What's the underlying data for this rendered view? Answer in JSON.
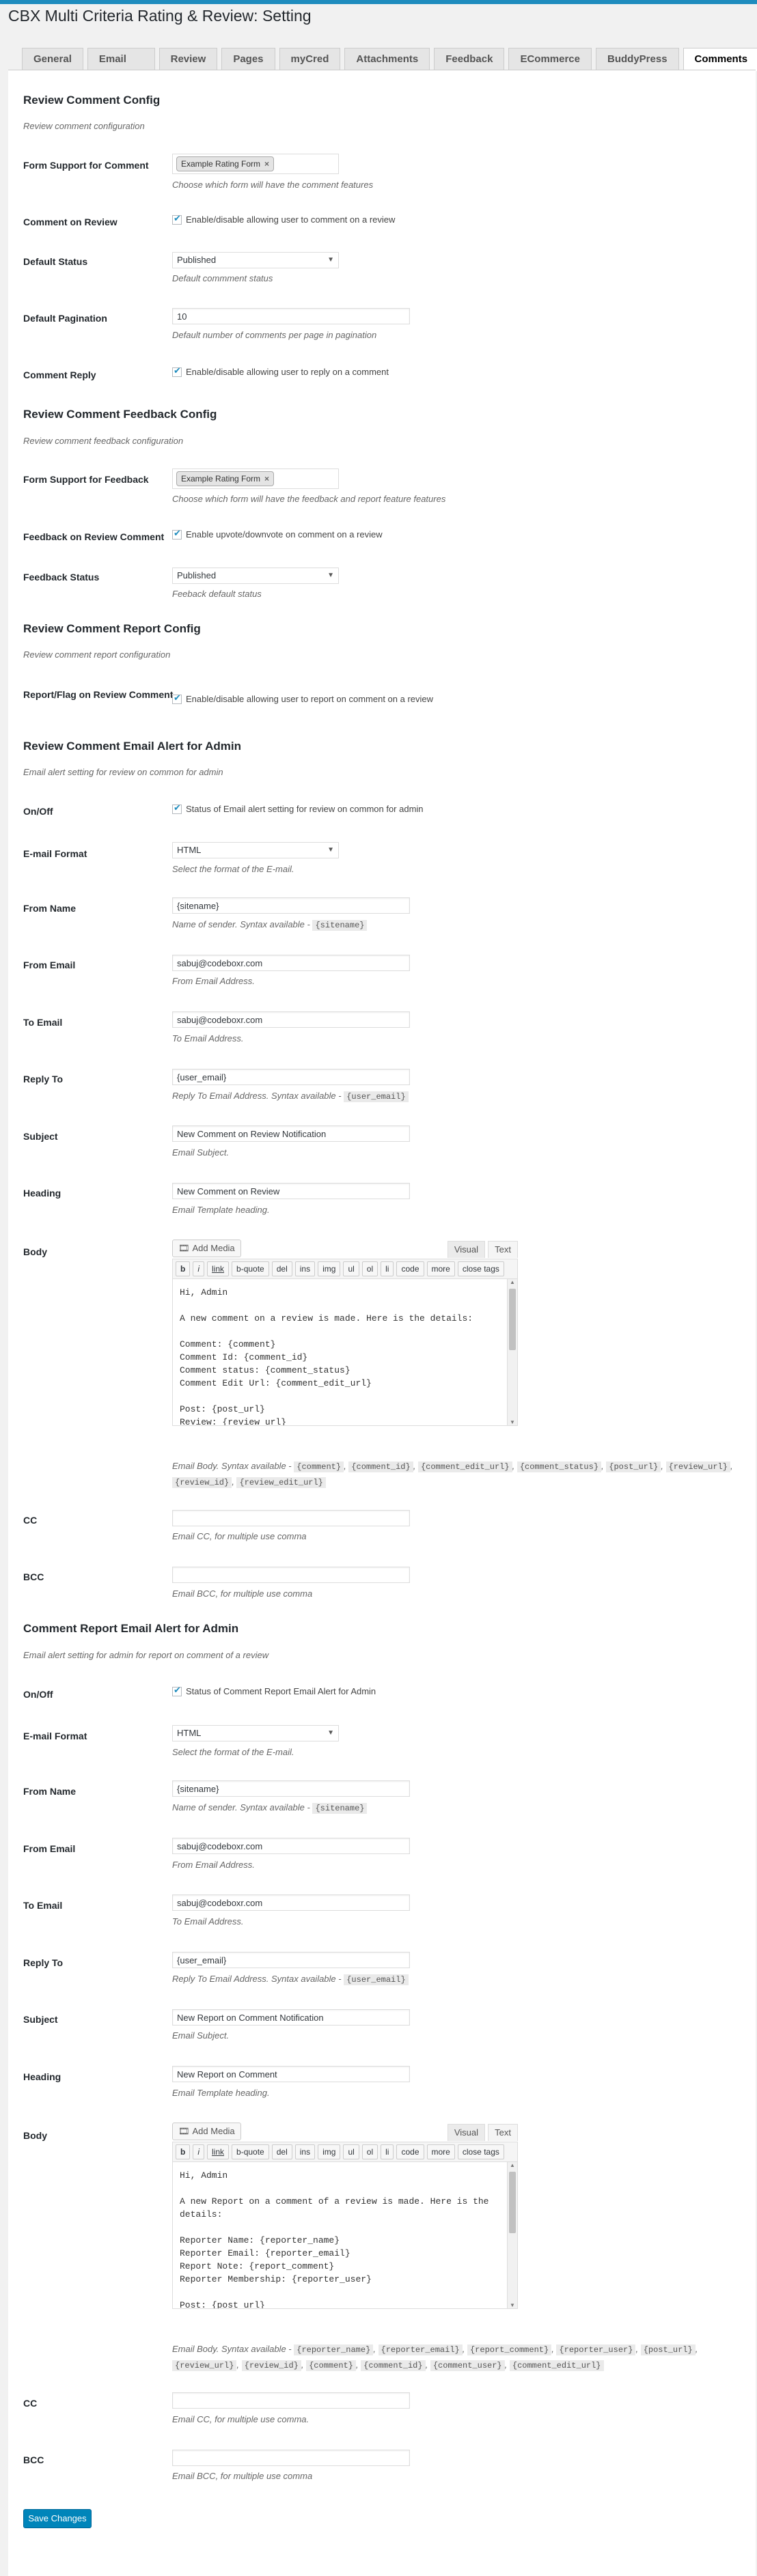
{
  "page": {
    "title": "CBX Multi Criteria Rating & Review: Setting"
  },
  "tabs": [
    "General",
    "Email Template",
    "Review Email",
    "Pages & Tools",
    "myCred",
    "Attachments",
    "Feedback",
    "ECommerce",
    "BuddyPress",
    "Comments"
  ],
  "sections": {
    "comment_config": {
      "title": "Review Comment Config",
      "desc": "Review comment configuration"
    },
    "feedback_config": {
      "title": "Review Comment Feedback Config",
      "desc": "Review comment feedback configuration"
    },
    "report_config": {
      "title": "Review Comment Report Config",
      "desc": "Review comment report configuration"
    },
    "email_alert": {
      "title": "Review Comment Email Alert for Admin",
      "desc": "Email alert setting for review on common for admin"
    },
    "report_email": {
      "title": "Comment Report Email Alert for Admin",
      "desc": "Email alert setting for admin for report on comment of a review"
    }
  },
  "fields": {
    "form_support": {
      "label": "Form Support for Comment",
      "chip": "Example Rating Form",
      "desc": "Choose which form will have the comment features"
    },
    "comment_on_review": {
      "label": "Comment on Review",
      "check": "Enable/disable allowing user to comment on a review"
    },
    "default_status": {
      "label": "Default Status",
      "value": "Published",
      "desc": "Default commment status"
    },
    "default_pagination": {
      "label": "Default Pagination",
      "value": "10",
      "desc": "Default number of comments per page in pagination"
    },
    "comment_reply": {
      "label": "Comment Reply",
      "check": "Enable/disable allowing user to reply on a comment"
    },
    "form_support_feedback": {
      "label": "Form Support for Feedback",
      "chip": "Example Rating Form",
      "desc": "Choose which form will have the feedback and report feature features"
    },
    "feedback_on_review": {
      "label": "Feedback on Review Comment",
      "check": "Enable upvote/downvote on comment on a review"
    },
    "feedback_status": {
      "label": "Feedback Status",
      "value": "Published",
      "desc": "Feeback default status"
    },
    "report_flag": {
      "label": "Report/Flag on Review Comment",
      "check": "Enable/disable allowing user to report on comment on a review"
    }
  },
  "email1": {
    "onoff": {
      "label": "On/Off",
      "check": "Status of Email alert setting for review on common for admin"
    },
    "format": {
      "label": "E-mail Format",
      "value": "HTML",
      "desc": "Select the format of the E-mail."
    },
    "from_name": {
      "label": "From Name",
      "value": "{sitename}",
      "desc": "Name of sender. Syntax available -",
      "code": "{sitename}"
    },
    "from_email": {
      "label": "From Email",
      "value": "sabuj@codeboxr.com",
      "desc": "From Email Address."
    },
    "to_email": {
      "label": "To Email",
      "value": "sabuj@codeboxr.com",
      "desc": "To Email Address."
    },
    "reply_to": {
      "label": "Reply To",
      "value": "{user_email}",
      "desc": "Reply To Email Address. Syntax available -",
      "code": "{user_email}"
    },
    "subject": {
      "label": "Subject",
      "value": "New Comment on Review Notification",
      "desc": "Email Subject."
    },
    "heading": {
      "label": "Heading",
      "value": "New Comment on Review",
      "desc": "Email Template heading."
    },
    "body": {
      "label": "Body",
      "text": "Hi, Admin\n\nA new comment on a review is made. Here is the details:\n\nComment: {comment}\nComment Id: {comment_id}\nComment status: {comment_status}\nComment Edit Url: {comment_edit_url}\n\nPost: {post_url}\nReview: {review_url}",
      "desc": "Email Body. Syntax available -",
      "codes": [
        "{comment}",
        "{comment_id}",
        "{comment_edit_url}",
        "{comment_status}",
        "{post_url}",
        "{review_url}",
        "{review_id}",
        "{review_edit_url}"
      ]
    },
    "cc": {
      "label": "CC",
      "value": "",
      "desc": "Email CC, for multiple use comma"
    },
    "bcc": {
      "label": "BCC",
      "value": "",
      "desc": "Email BCC, for multiple use comma"
    }
  },
  "email2": {
    "onoff": {
      "label": "On/Off",
      "check": "Status of Comment Report Email Alert for Admin"
    },
    "format": {
      "label": "E-mail Format",
      "value": "HTML",
      "desc": "Select the format of the E-mail."
    },
    "from_name": {
      "label": "From Name",
      "value": "{sitename}",
      "desc": "Name of sender. Syntax available -",
      "code": "{sitename}"
    },
    "from_email": {
      "label": "From Email",
      "value": "sabuj@codeboxr.com",
      "desc": "From Email Address."
    },
    "to_email": {
      "label": "To Email",
      "value": "sabuj@codeboxr.com",
      "desc": "To Email Address."
    },
    "reply_to": {
      "label": "Reply To",
      "value": "{user_email}",
      "desc": "Reply To Email Address. Syntax available -",
      "code": "{user_email}"
    },
    "subject": {
      "label": "Subject",
      "value": "New Report on Comment Notification",
      "desc": "Email Subject."
    },
    "heading": {
      "label": "Heading",
      "value": "New Report on Comment",
      "desc": "Email Template heading."
    },
    "body": {
      "label": "Body",
      "text": "Hi, Admin\n\nA new Report on a comment of a review is made. Here is the details:\n\nReporter Name: {reporter_name}\nReporter Email: {reporter_email}\nReport Note: {report_comment}\nReporter Membership: {reporter_user}\n\nPost: {post_url}",
      "desc": "Email Body. Syntax available -",
      "codes": [
        "{reporter_name}",
        "{reporter_email}",
        "{report_comment}",
        "{reporter_user}",
        "{post_url}",
        "{review_url}",
        "{review_id}",
        "{comment}",
        "{comment_id}",
        "{comment_user}",
        "{comment_edit_url}"
      ]
    },
    "cc": {
      "label": "CC",
      "value": "",
      "desc": "Email CC, for multiple use comma."
    },
    "bcc": {
      "label": "BCC",
      "value": "",
      "desc": "Email BCC, for multiple use comma"
    }
  },
  "editor": {
    "add_media": "Add Media",
    "visual": "Visual",
    "text": "Text",
    "buttons": [
      "b",
      "i",
      "link",
      "b-quote",
      "del",
      "ins",
      "img",
      "ul",
      "ol",
      "li",
      "code",
      "more",
      "close tags"
    ]
  },
  "save_label": "Save Changes",
  "colors": {
    "accent": "#0085ba",
    "topbar": "#1e8cbe"
  }
}
